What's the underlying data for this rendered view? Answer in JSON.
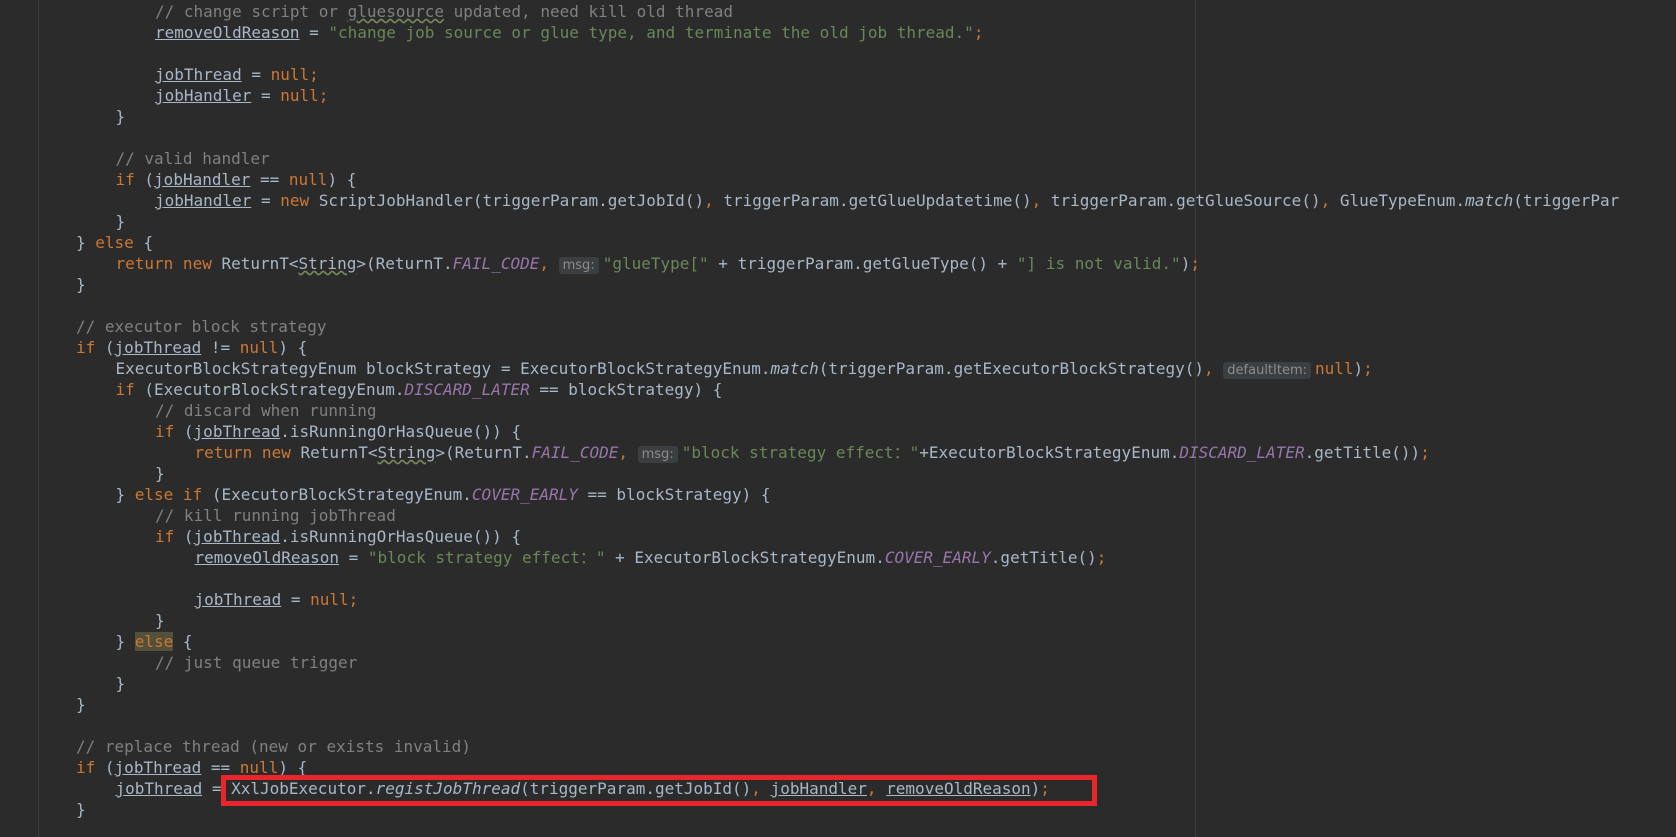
{
  "editor": {
    "lines": [
      {
        "indent": 4,
        "parts": [
          [
            "cmt",
            "// change script or "
          ],
          [
            "cmt squig",
            "gluesource"
          ],
          [
            "cmt",
            " updated, need kill old thread"
          ]
        ]
      },
      {
        "indent": 4,
        "parts": [
          [
            "var",
            "removeOldReason"
          ],
          [
            "p",
            " = "
          ],
          [
            "str",
            "\"change job source or glue type, and terminate the old job thread.\""
          ],
          [
            "kw",
            ";"
          ]
        ]
      },
      {
        "indent": 4,
        "parts": []
      },
      {
        "indent": 4,
        "parts": [
          [
            "var",
            "jobThread"
          ],
          [
            "p",
            " = "
          ],
          [
            "kw",
            "null;"
          ]
        ]
      },
      {
        "indent": 4,
        "parts": [
          [
            "var",
            "jobHandler"
          ],
          [
            "p",
            " = "
          ],
          [
            "kw",
            "null;"
          ]
        ]
      },
      {
        "indent": 3,
        "parts": [
          [
            "p",
            "}"
          ]
        ]
      },
      {
        "indent": 3,
        "parts": []
      },
      {
        "indent": 3,
        "parts": [
          [
            "cmt",
            "// valid handler"
          ]
        ]
      },
      {
        "indent": 3,
        "parts": [
          [
            "kw",
            "if "
          ],
          [
            "p",
            "("
          ],
          [
            "var",
            "jobHandler"
          ],
          [
            "p",
            " == "
          ],
          [
            "kw",
            "null"
          ],
          [
            "p",
            ") {"
          ]
        ]
      },
      {
        "indent": 4,
        "parts": [
          [
            "var",
            "jobHandler"
          ],
          [
            "p",
            " = "
          ],
          [
            "kw",
            "new "
          ],
          [
            "p",
            "ScriptJobHandler(triggerParam.getJobId()"
          ],
          [
            "kw",
            ", "
          ],
          [
            "p",
            "triggerParam.getGlueUpdatetime()"
          ],
          [
            "kw",
            ", "
          ],
          [
            "p",
            "triggerParam.getGlueSource()"
          ],
          [
            "kw",
            ", "
          ],
          [
            "p",
            "GlueTypeEnum."
          ],
          [
            "mth",
            "match"
          ],
          [
            "p",
            "(triggerPar"
          ]
        ]
      },
      {
        "indent": 3,
        "parts": [
          [
            "p",
            "}"
          ]
        ]
      },
      {
        "indent": 2,
        "parts": [
          [
            "p",
            "} "
          ],
          [
            "kw",
            "else "
          ],
          [
            "p",
            "{"
          ]
        ]
      },
      {
        "indent": 3,
        "parts": [
          [
            "kw",
            "return new "
          ],
          [
            "p",
            "ReturnT<"
          ],
          [
            "squig",
            "String"
          ],
          [
            "p",
            ">(ReturnT."
          ],
          [
            "fld",
            "FAIL_CODE"
          ],
          [
            "kw",
            ", "
          ],
          [
            "hint",
            "msg:"
          ],
          [
            "str",
            "\"glueType[\""
          ],
          [
            "p",
            " + triggerParam.getGlueType() + "
          ],
          [
            "str",
            "\"] is not valid.\""
          ],
          [
            "p",
            ")"
          ],
          [
            "kw",
            ";"
          ]
        ]
      },
      {
        "indent": 2,
        "parts": [
          [
            "p",
            "}"
          ]
        ]
      },
      {
        "indent": 2,
        "parts": []
      },
      {
        "indent": 2,
        "parts": [
          [
            "cmt",
            "// executor block strategy"
          ]
        ]
      },
      {
        "indent": 2,
        "parts": [
          [
            "kw",
            "if "
          ],
          [
            "p",
            "("
          ],
          [
            "var",
            "jobThread"
          ],
          [
            "p",
            " != "
          ],
          [
            "kw",
            "null"
          ],
          [
            "p",
            ") {"
          ]
        ]
      },
      {
        "indent": 3,
        "parts": [
          [
            "p",
            "ExecutorBlockStrategyEnum blockStrategy = ExecutorBlockStrategyEnum."
          ],
          [
            "mth",
            "match"
          ],
          [
            "p",
            "(triggerParam.getExecutorBlockStrategy()"
          ],
          [
            "kw",
            ", "
          ],
          [
            "hint",
            "defaultItem:"
          ],
          [
            "kw",
            "null"
          ],
          [
            "p",
            ")"
          ],
          [
            "kw",
            ";"
          ]
        ]
      },
      {
        "indent": 3,
        "parts": [
          [
            "kw",
            "if "
          ],
          [
            "p",
            "(ExecutorBlockStrategyEnum."
          ],
          [
            "fld",
            "DISCARD_LATER"
          ],
          [
            "p",
            " == blockStrategy) {"
          ]
        ]
      },
      {
        "indent": 4,
        "parts": [
          [
            "cmt",
            "// discard when running"
          ]
        ]
      },
      {
        "indent": 4,
        "parts": [
          [
            "kw",
            "if "
          ],
          [
            "p",
            "("
          ],
          [
            "var",
            "jobThread"
          ],
          [
            "p",
            ".isRunningOrHasQueue()) {"
          ]
        ]
      },
      {
        "indent": 5,
        "parts": [
          [
            "kw",
            "return new "
          ],
          [
            "p",
            "ReturnT<"
          ],
          [
            "squig",
            "String"
          ],
          [
            "p",
            ">(ReturnT."
          ],
          [
            "fld",
            "FAIL_CODE"
          ],
          [
            "kw",
            ", "
          ],
          [
            "hint",
            "msg:"
          ],
          [
            "str",
            "\"block strategy effect：\""
          ],
          [
            "p",
            "+ExecutorBlockStrategyEnum."
          ],
          [
            "fld",
            "DISCARD_LATER"
          ],
          [
            "p",
            ".getTitle())"
          ],
          [
            "kw",
            ";"
          ]
        ]
      },
      {
        "indent": 4,
        "parts": [
          [
            "p",
            "}"
          ]
        ]
      },
      {
        "indent": 3,
        "parts": [
          [
            "p",
            "} "
          ],
          [
            "kw",
            "else if "
          ],
          [
            "p",
            "(ExecutorBlockStrategyEnum."
          ],
          [
            "fld",
            "COVER_EARLY"
          ],
          [
            "p",
            " == blockStrategy) {"
          ]
        ]
      },
      {
        "indent": 4,
        "parts": [
          [
            "cmt",
            "// kill running jobThread"
          ]
        ]
      },
      {
        "indent": 4,
        "parts": [
          [
            "kw",
            "if "
          ],
          [
            "p",
            "("
          ],
          [
            "var",
            "jobThread"
          ],
          [
            "p",
            ".isRunningOrHasQueue()) {"
          ]
        ]
      },
      {
        "indent": 5,
        "parts": [
          [
            "var",
            "removeOldReason"
          ],
          [
            "p",
            " = "
          ],
          [
            "str",
            "\"block strategy effect：\""
          ],
          [
            "p",
            " + ExecutorBlockStrategyEnum."
          ],
          [
            "fld",
            "COVER_EARLY"
          ],
          [
            "p",
            ".getTitle()"
          ],
          [
            "kw",
            ";"
          ]
        ]
      },
      {
        "indent": 5,
        "parts": []
      },
      {
        "indent": 5,
        "parts": [
          [
            "var",
            "jobThread"
          ],
          [
            "p",
            " = "
          ],
          [
            "kw",
            "null;"
          ]
        ]
      },
      {
        "indent": 4,
        "parts": [
          [
            "p",
            "}"
          ]
        ]
      },
      {
        "indent": 3,
        "parts": [
          [
            "p",
            "} "
          ],
          [
            "kw else-hl",
            "else"
          ],
          [
            "p",
            " {"
          ]
        ]
      },
      {
        "indent": 4,
        "parts": [
          [
            "cmt",
            "// just queue trigger"
          ]
        ]
      },
      {
        "indent": 3,
        "parts": [
          [
            "p",
            "}"
          ]
        ]
      },
      {
        "indent": 2,
        "parts": [
          [
            "p",
            "}"
          ]
        ]
      },
      {
        "indent": 2,
        "parts": []
      },
      {
        "indent": 2,
        "parts": [
          [
            "cmt",
            "// replace thread (new or exists invalid)"
          ]
        ]
      },
      {
        "indent": 2,
        "parts": [
          [
            "kw",
            "if "
          ],
          [
            "p",
            "("
          ],
          [
            "var",
            "jobThread"
          ],
          [
            "p",
            " == "
          ],
          [
            "kw",
            "null"
          ],
          [
            "p",
            ") {"
          ]
        ]
      },
      {
        "indent": 3,
        "parts": [
          [
            "var",
            "jobThread"
          ],
          [
            "p",
            " = "
          ],
          [
            "p",
            "XxlJobExecutor."
          ],
          [
            "mth",
            "registJobThread"
          ],
          [
            "p",
            "(triggerParam.getJobId()"
          ],
          [
            "kw",
            ", "
          ],
          [
            "var",
            "jobHandler"
          ],
          [
            "kw",
            ", "
          ],
          [
            "var",
            "removeOldReason"
          ],
          [
            "p",
            ")"
          ],
          [
            "kw",
            ";"
          ]
        ]
      },
      {
        "indent": 2,
        "parts": [
          [
            "p",
            "}"
          ]
        ]
      }
    ]
  },
  "highlight": {
    "color": "#e8262c",
    "label": "XxlJobExecutor.registJobThread call highlighted"
  }
}
